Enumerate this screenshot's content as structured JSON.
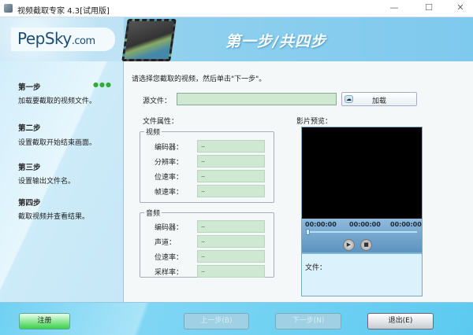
{
  "window": {
    "title": "视频截取专家 4.3[试用版]",
    "minimize": "—",
    "maximize": "☐",
    "close": "✕"
  },
  "logo": {
    "brand": "PepSky",
    "suffix": ".com"
  },
  "header": {
    "step_title": "第一步/共四步"
  },
  "sidebar": {
    "steps": [
      {
        "title": "第一步",
        "desc": "加载要截取的视频文件。"
      },
      {
        "title": "第二步",
        "desc": "设置截取开始结束画面。"
      },
      {
        "title": "第三步",
        "desc": "设置输出文件名。"
      },
      {
        "title": "第四步",
        "desc": "截取视频并查看结果。"
      }
    ],
    "active_indicator": "●●●"
  },
  "main": {
    "instruction": "请选择您截取的视频，然后单击\"下一步\"。",
    "source_label": "源文件：",
    "source_value": "",
    "load_button": "加载",
    "props_label": "文件属性：",
    "video": {
      "title": "视频",
      "rows": [
        {
          "label": "编码器：",
          "value": ".."
        },
        {
          "label": "分辨率：",
          "value": ".."
        },
        {
          "label": "位速率：",
          "value": ".."
        },
        {
          "label": "帧速率：",
          "value": ".."
        }
      ]
    },
    "audio": {
      "title": "音频",
      "rows": [
        {
          "label": "编码器：",
          "value": ".."
        },
        {
          "label": "声道：",
          "value": ".."
        },
        {
          "label": "位速率：",
          "value": ".."
        },
        {
          "label": "采样率：",
          "value": ".."
        }
      ]
    },
    "preview": {
      "label": "影片预览：",
      "time_start": "00:00:00",
      "time_current": "00:00:00",
      "time_end": "00:00:00",
      "position": 0,
      "file_label": "文件："
    }
  },
  "footer": {
    "register": "注册",
    "prev": "上一步(B)",
    "next": "下一步(N)",
    "exit": "退出(E)"
  }
}
